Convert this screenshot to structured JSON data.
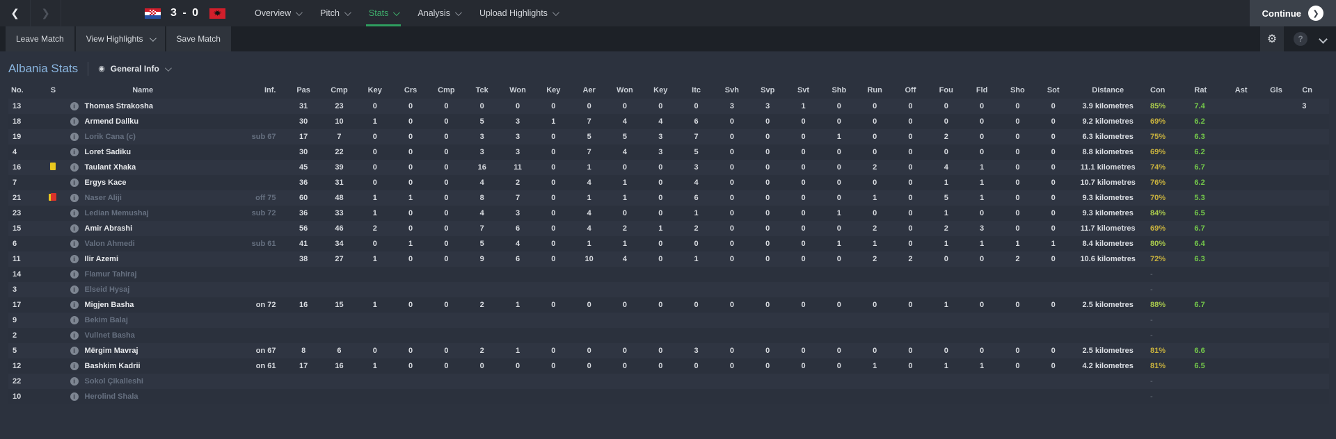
{
  "top_bar": {
    "score": "3 - 0",
    "home_flag": "Croatia",
    "away_flag": "Albania",
    "nav": [
      {
        "label": "Overview",
        "active": false
      },
      {
        "label": "Pitch",
        "active": false
      },
      {
        "label": "Stats",
        "active": true
      },
      {
        "label": "Analysis",
        "active": false
      },
      {
        "label": "Upload Highlights",
        "active": false
      }
    ],
    "continue_label": "Continue"
  },
  "toolbar": {
    "leave_match": "Leave Match",
    "view_highlights": "View Highlights",
    "save_match": "Save Match",
    "help_label": "?"
  },
  "page": {
    "title": "Albania Stats",
    "view_selector": "General Info"
  },
  "colors": {
    "accent_green": "#2f9e5f",
    "nav_active_green": "#3fae6c",
    "title_blue": "#8ab6e0",
    "con_high": "#a9c94d",
    "con_mid": "#c9b23e",
    "rating_green": "#74c94a",
    "card_yellow": "#e9c71e",
    "card_red": "#d9332a"
  },
  "table": {
    "columns": [
      "No.",
      "S",
      "Name",
      "Inf.",
      "Pas",
      "Cmp",
      "Key",
      "Crs",
      "Cmp",
      "Tck",
      "Won",
      "Key",
      "Aer",
      "Won",
      "Key",
      "Itc",
      "Svh",
      "Svp",
      "Svt",
      "Shb",
      "Run",
      "Off",
      "Fou",
      "Fld",
      "Sho",
      "Sot",
      "Distance",
      "Con",
      "Rat",
      "Ast",
      "Gls",
      "Cn"
    ],
    "column_keys": [
      "no",
      "s",
      "name",
      "inf",
      "pas",
      "cmp",
      "key",
      "crs",
      "cmp2",
      "tck",
      "won",
      "key2",
      "aer",
      "won2",
      "key3",
      "itc",
      "svh",
      "svp",
      "svt",
      "shb",
      "run",
      "off",
      "fou",
      "fld",
      "sho",
      "sot",
      "distance",
      "con",
      "rat",
      "ast",
      "gls",
      "cn"
    ],
    "rows": [
      {
        "no": "13",
        "card": "",
        "name": "Thomas Strakosha",
        "dim": false,
        "inf": "",
        "stats": [
          31,
          23,
          0,
          0,
          0,
          0,
          0,
          0,
          0,
          0,
          0,
          0,
          3,
          3,
          1,
          0,
          0,
          0,
          0,
          0,
          0,
          0
        ],
        "dist": "3.9 kilometres",
        "con": "85%",
        "conlvl": "high",
        "rat": "7.4",
        "ast": "",
        "gls": "",
        "cn": "3"
      },
      {
        "no": "18",
        "card": "",
        "name": "Armend Dallku",
        "dim": false,
        "inf": "",
        "stats": [
          30,
          10,
          1,
          0,
          0,
          5,
          3,
          1,
          7,
          4,
          4,
          6,
          0,
          0,
          0,
          0,
          0,
          0,
          0,
          0,
          0,
          0
        ],
        "dist": "9.2 kilometres",
        "con": "69%",
        "conlvl": "mid",
        "rat": "6.2",
        "ast": "",
        "gls": "",
        "cn": ""
      },
      {
        "no": "19",
        "card": "",
        "name": "Lorik Cana (c)",
        "dim": true,
        "inf": "sub 67",
        "stats": [
          17,
          7,
          0,
          0,
          0,
          3,
          3,
          0,
          5,
          5,
          3,
          7,
          0,
          0,
          0,
          1,
          0,
          0,
          2,
          0,
          0,
          0
        ],
        "dist": "6.3 kilometres",
        "con": "75%",
        "conlvl": "mid",
        "rat": "6.3",
        "ast": "",
        "gls": "",
        "cn": ""
      },
      {
        "no": "4",
        "card": "",
        "name": "Loret Sadiku",
        "dim": false,
        "inf": "",
        "stats": [
          30,
          22,
          0,
          0,
          0,
          3,
          3,
          0,
          7,
          4,
          3,
          5,
          0,
          0,
          0,
          0,
          0,
          0,
          0,
          0,
          0,
          0
        ],
        "dist": "8.8 kilometres",
        "con": "69%",
        "conlvl": "mid",
        "rat": "6.2",
        "ast": "",
        "gls": "",
        "cn": ""
      },
      {
        "no": "16",
        "card": "yellow",
        "name": "Taulant Xhaka",
        "dim": false,
        "inf": "",
        "stats": [
          45,
          39,
          0,
          0,
          0,
          16,
          11,
          0,
          1,
          0,
          0,
          3,
          0,
          0,
          0,
          0,
          2,
          0,
          4,
          1,
          0,
          0
        ],
        "dist": "11.1 kilometres",
        "con": "74%",
        "conlvl": "mid",
        "rat": "6.7",
        "ast": "",
        "gls": "",
        "cn": ""
      },
      {
        "no": "7",
        "card": "",
        "name": "Ergys Kace",
        "dim": false,
        "inf": "",
        "stats": [
          36,
          31,
          0,
          0,
          0,
          4,
          2,
          0,
          4,
          1,
          0,
          4,
          0,
          0,
          0,
          0,
          0,
          0,
          1,
          1,
          0,
          0
        ],
        "dist": "10.7 kilometres",
        "con": "76%",
        "conlvl": "mid",
        "rat": "6.2",
        "ast": "",
        "gls": "",
        "cn": ""
      },
      {
        "no": "21",
        "card": "yellow-red",
        "name": "Naser Aliji",
        "dim": true,
        "inf": "off 75",
        "stats": [
          60,
          48,
          1,
          1,
          0,
          8,
          7,
          0,
          1,
          1,
          0,
          6,
          0,
          0,
          0,
          0,
          1,
          0,
          5,
          1,
          0,
          0
        ],
        "dist": "9.3 kilometres",
        "con": "70%",
        "conlvl": "mid",
        "rat": "5.3",
        "ast": "",
        "gls": "",
        "cn": ""
      },
      {
        "no": "23",
        "card": "",
        "name": "Ledian Memushaj",
        "dim": true,
        "inf": "sub 72",
        "stats": [
          36,
          33,
          1,
          0,
          0,
          4,
          3,
          0,
          4,
          0,
          0,
          1,
          0,
          0,
          0,
          1,
          0,
          0,
          1,
          0,
          0,
          0
        ],
        "dist": "9.3 kilometres",
        "con": "84%",
        "conlvl": "high",
        "rat": "6.5",
        "ast": "",
        "gls": "",
        "cn": ""
      },
      {
        "no": "15",
        "card": "",
        "name": "Amir Abrashi",
        "dim": false,
        "inf": "",
        "stats": [
          56,
          46,
          2,
          0,
          0,
          7,
          6,
          0,
          4,
          2,
          1,
          2,
          0,
          0,
          0,
          0,
          2,
          0,
          2,
          3,
          0,
          0
        ],
        "dist": "11.7 kilometres",
        "con": "69%",
        "conlvl": "mid",
        "rat": "6.7",
        "ast": "",
        "gls": "",
        "cn": ""
      },
      {
        "no": "6",
        "card": "",
        "name": "Valon Ahmedi",
        "dim": true,
        "inf": "sub 61",
        "stats": [
          41,
          34,
          0,
          1,
          0,
          5,
          4,
          0,
          1,
          1,
          0,
          0,
          0,
          0,
          0,
          1,
          1,
          0,
          1,
          1,
          1,
          1
        ],
        "dist": "8.4 kilometres",
        "con": "80%",
        "conlvl": "high",
        "rat": "6.4",
        "ast": "",
        "gls": "",
        "cn": ""
      },
      {
        "no": "11",
        "card": "",
        "name": "Ilir Azemi",
        "dim": false,
        "inf": "",
        "stats": [
          38,
          27,
          1,
          0,
          0,
          9,
          6,
          0,
          10,
          4,
          0,
          1,
          0,
          0,
          0,
          0,
          2,
          2,
          0,
          0,
          2,
          0
        ],
        "dist": "10.6 kilometres",
        "con": "72%",
        "conlvl": "mid",
        "rat": "6.3",
        "ast": "",
        "gls": "",
        "cn": ""
      },
      {
        "no": "14",
        "card": "",
        "name": "Flamur Tahiraj",
        "dim": true,
        "inf": "",
        "stats": [],
        "dist": "",
        "con": "-",
        "conlvl": "none",
        "rat": "",
        "ast": "",
        "gls": "",
        "cn": ""
      },
      {
        "no": "3",
        "card": "",
        "name": "Elseid Hysaj",
        "dim": true,
        "inf": "",
        "stats": [],
        "dist": "",
        "con": "-",
        "conlvl": "none",
        "rat": "",
        "ast": "",
        "gls": "",
        "cn": ""
      },
      {
        "no": "17",
        "card": "",
        "name": "Migjen Basha",
        "dim": false,
        "inf": "on 72",
        "stats": [
          16,
          15,
          1,
          0,
          0,
          2,
          1,
          0,
          0,
          0,
          0,
          0,
          0,
          0,
          0,
          0,
          0,
          0,
          1,
          0,
          0,
          0
        ],
        "dist": "2.5 kilometres",
        "con": "88%",
        "conlvl": "high",
        "rat": "6.7",
        "ast": "",
        "gls": "",
        "cn": ""
      },
      {
        "no": "9",
        "card": "",
        "name": "Bekim Balaj",
        "dim": true,
        "inf": "",
        "stats": [],
        "dist": "",
        "con": "-",
        "conlvl": "none",
        "rat": "",
        "ast": "",
        "gls": "",
        "cn": ""
      },
      {
        "no": "2",
        "card": "",
        "name": "Vullnet Basha",
        "dim": true,
        "inf": "",
        "stats": [],
        "dist": "",
        "con": "-",
        "conlvl": "none",
        "rat": "",
        "ast": "",
        "gls": "",
        "cn": ""
      },
      {
        "no": "5",
        "card": "",
        "name": "Mërgim Mavraj",
        "dim": false,
        "inf": "on 67",
        "stats": [
          8,
          6,
          0,
          0,
          0,
          2,
          1,
          0,
          0,
          0,
          0,
          3,
          0,
          0,
          0,
          0,
          0,
          0,
          0,
          0,
          0,
          0
        ],
        "dist": "2.5 kilometres",
        "con": "81%",
        "conlvl": "mid",
        "rat": "6.6",
        "ast": "",
        "gls": "",
        "cn": ""
      },
      {
        "no": "12",
        "card": "",
        "name": "Bashkim Kadrii",
        "dim": false,
        "inf": "on 61",
        "stats": [
          17,
          16,
          1,
          0,
          0,
          0,
          0,
          0,
          0,
          0,
          0,
          0,
          0,
          0,
          0,
          0,
          1,
          0,
          1,
          1,
          0,
          0
        ],
        "dist": "4.2 kilometres",
        "con": "81%",
        "conlvl": "mid",
        "rat": "6.5",
        "ast": "",
        "gls": "",
        "cn": ""
      },
      {
        "no": "22",
        "card": "",
        "name": "Sokol Çikalleshi",
        "dim": true,
        "inf": "",
        "stats": [],
        "dist": "",
        "con": "-",
        "conlvl": "none",
        "rat": "",
        "ast": "",
        "gls": "",
        "cn": ""
      },
      {
        "no": "10",
        "card": "",
        "name": "Herolind Shala",
        "dim": true,
        "inf": "",
        "stats": [],
        "dist": "",
        "con": "-",
        "conlvl": "none",
        "rat": "",
        "ast": "",
        "gls": "",
        "cn": ""
      }
    ]
  }
}
